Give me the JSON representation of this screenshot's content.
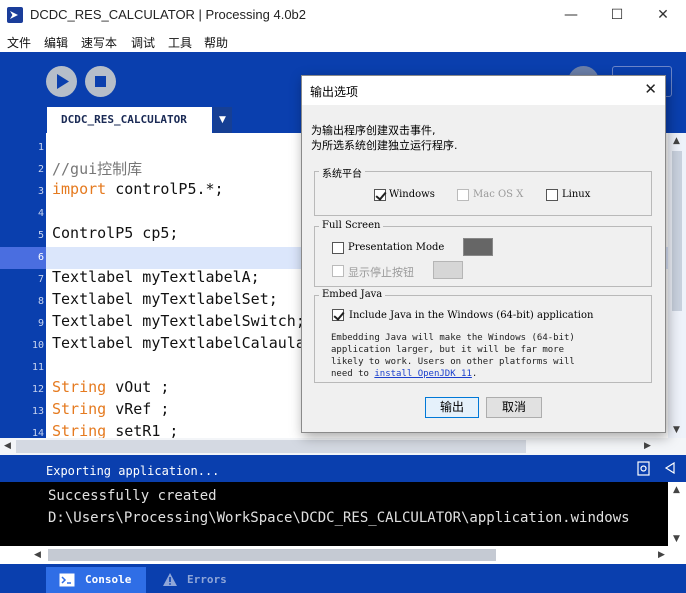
{
  "window": {
    "title": "DCDC_RES_CALCULATOR | Processing 4.0b2",
    "controls": {
      "minimize": "—",
      "maximize": "☐",
      "close": "✕"
    }
  },
  "menu": [
    "文件",
    "编辑",
    "速写本",
    "调试",
    "工具",
    "帮助"
  ],
  "editor": {
    "tab_label": "DCDC_RES_CALCULATOR",
    "tab_menu_arrow": "▼",
    "line_numbers": [
      "1",
      "2",
      "3",
      "4",
      "5",
      "6",
      "7",
      "8",
      "9",
      "10",
      "11",
      "12",
      "13",
      "14"
    ],
    "lines": [
      {
        "plain": ""
      },
      {
        "cm": "//gui控制库"
      },
      {
        "kw": "import",
        "plain": " controlP5.*;"
      },
      {
        "plain": ""
      },
      {
        "plain": "ControlP5 cp5;"
      },
      {
        "plain": ""
      },
      {
        "plain": "Textlabel myTextlabelA;"
      },
      {
        "plain": "Textlabel myTextlabelSet;"
      },
      {
        "plain": "Textlabel myTextlabelSwitch;"
      },
      {
        "plain": "Textlabel myTextlabelCalaula"
      },
      {
        "plain": ""
      },
      {
        "kw": "String",
        "plain": " vOut ;"
      },
      {
        "kw": "String",
        "plain": " vRef ;"
      },
      {
        "kw": "String",
        "plain": " setR1 ;"
      }
    ],
    "current_line": "6"
  },
  "status": {
    "message": "Exporting application..."
  },
  "console": {
    "lines": [
      "Successfully created",
      "D:\\Users\\Processing\\WorkSpace\\DCDC_RES_CALCULATOR\\application.windows"
    ]
  },
  "bottom_tabs": [
    {
      "label": "Console",
      "icon": "console-icon"
    },
    {
      "label": "Errors",
      "icon": "warning-icon"
    }
  ],
  "dialog": {
    "title": "输出选项",
    "close": "✕",
    "intro": [
      "为输出程序创建双击事件,",
      "为所选系统创建独立运行程序."
    ],
    "platform": {
      "label": "系统平台",
      "windows": {
        "label": "Windows",
        "checked": true
      },
      "macos": {
        "label": "Mac OS X",
        "checked": false,
        "disabled": true
      },
      "linux": {
        "label": "Linux",
        "checked": false
      }
    },
    "fullscreen": {
      "label": "Full Screen",
      "presentation_mode": {
        "label": "Presentation Mode",
        "checked": false,
        "swatch_color": "#666666"
      },
      "show_stop": {
        "label": "显示停止按钮",
        "checked": false,
        "disabled": true,
        "swatch_color": "#d6d6d6"
      }
    },
    "embed_java": {
      "label": "Embed Java",
      "include": {
        "label": "Include Java in the Windows (64-bit) application",
        "checked": true
      },
      "description": [
        "Embedding Java will make the Windows (64-bit)",
        "application larger, but it will be far more",
        "likely to work. Users on other platforms will"
      ],
      "need_prefix": "need to ",
      "link_text": "install OpenJDK 11",
      "need_suffix": "."
    },
    "buttons": {
      "export": "输出",
      "cancel": "取消"
    }
  },
  "colors": {
    "chrome_blue": "#0a3fae",
    "keyword": "#e57a1f",
    "comment": "#777777",
    "current_line": "#dbe6fb"
  }
}
